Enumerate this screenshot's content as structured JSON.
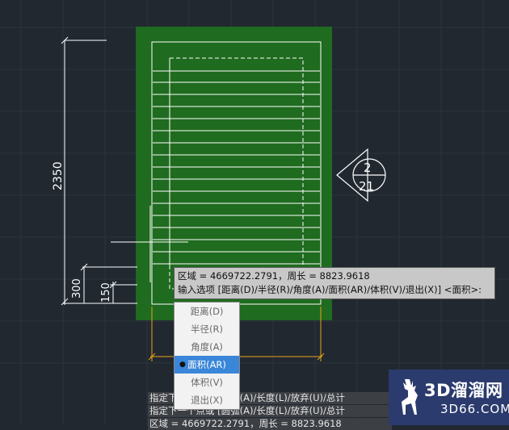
{
  "drawing": {
    "dim_height": "2350",
    "dim_300": "300",
    "dim_150": "150",
    "section_marker_top": "2",
    "section_marker_bottom": "21"
  },
  "tooltip": {
    "line1": "区域 = 4669722.2791，周长 = 8823.9618",
    "line2": "输入选项 [距离(D)/半径(R)/角度(A)/面积(AR)/体积(V)/退出(X)] <面积>:"
  },
  "menu": {
    "items": [
      {
        "label": "距离(D)",
        "selected": false
      },
      {
        "label": "半径(R)",
        "selected": false
      },
      {
        "label": "角度(A)",
        "selected": false
      },
      {
        "label": "面积(AR)",
        "selected": true
      },
      {
        "label": "体积(V)",
        "selected": false
      },
      {
        "label": "退出(X)",
        "selected": false
      }
    ],
    "bullet": "●"
  },
  "command_history": [
    "指定下一个点或 [圆弧(A)/长度(L)/放弃(U)/总计",
    "指定下一个点或 [圆弧(A)/长度(L)/放弃(U)/总计",
    "区域 = 4669722.2791，周长 = 8823.9618"
  ],
  "watermark": {
    "title": "3D溜溜网",
    "subtitle": "3D66.COM"
  },
  "colors": {
    "background": "#212830",
    "fill_green": "#1f6b1f",
    "orange_dim": "#e8a317",
    "menu_highlight": "#3a86d8"
  }
}
